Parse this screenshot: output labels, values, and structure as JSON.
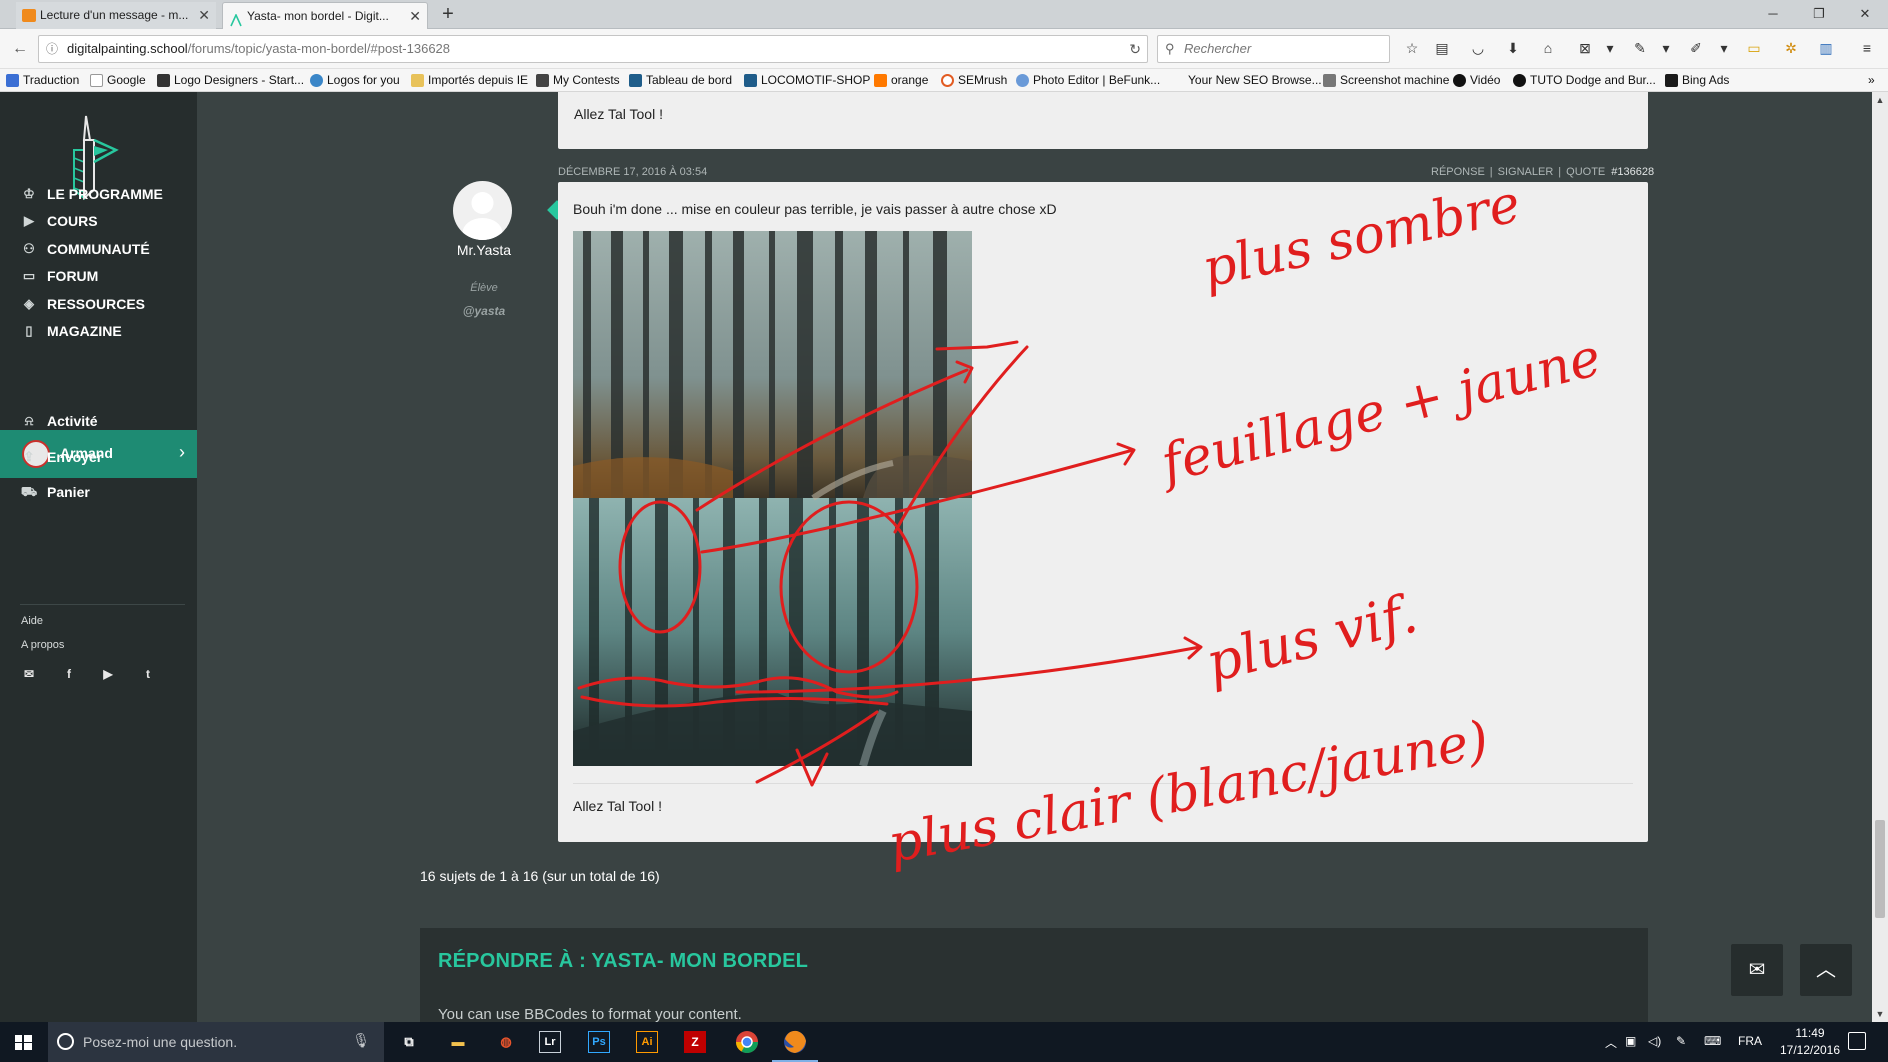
{
  "browser": {
    "tabs": [
      {
        "title": "Lecture d'un message - m..."
      },
      {
        "title": "Yasta- mon bordel - Digit..."
      }
    ],
    "new_tab_label": "+",
    "url_domain": "digitalpainting.school",
    "url_path": "/forums/topic/yasta-mon-bordel/#post-136628",
    "search_placeholder": "Rechercher",
    "bookmarks": [
      "Traduction",
      "Google",
      "Logo Designers - Start...",
      "Logos for you",
      "Importés depuis IE",
      "My Contests",
      "Tableau de bord",
      "LOCOMOTIF-SHOP",
      "orange",
      "SEMrush",
      "Photo Editor | BeFunk...",
      "Your New SEO Browse...",
      "Screenshot machine",
      "Vidéo",
      "TUTO Dodge and Bur...",
      "Bing Ads"
    ]
  },
  "sidebar": {
    "nav": [
      {
        "label": "LE PROGRAMME",
        "icon": "award-icon"
      },
      {
        "label": "COURS",
        "icon": "play-icon"
      },
      {
        "label": "COMMUNAUTÉ",
        "icon": "users-icon"
      },
      {
        "label": "FORUM",
        "icon": "chat-icon"
      },
      {
        "label": "RESSOURCES",
        "icon": "layers-icon"
      },
      {
        "label": "MAGAZINE",
        "icon": "book-icon"
      }
    ],
    "user": {
      "name": "Armand"
    },
    "subnav": [
      {
        "label": "Activité",
        "icon": "bell-icon"
      },
      {
        "label": "Envoyer",
        "icon": "upload-icon"
      },
      {
        "label": "Panier",
        "icon": "cart-icon"
      }
    ],
    "links": [
      "Aide",
      "A propos"
    ],
    "social": [
      "mail-icon",
      "facebook-icon",
      "youtube-icon",
      "twitter-icon"
    ]
  },
  "prev_post": {
    "text": "Allez Tal Tool !"
  },
  "post": {
    "date": "DÉCEMBRE 17, 2016 À 03:54",
    "actions": [
      "RÉPONSE",
      "SIGNALER",
      "QUOTE"
    ],
    "post_id": "#136628",
    "author": {
      "name": "Mr.Yasta",
      "role": "Élève",
      "handle": "@yasta"
    },
    "text": "Bouh i'm done ... mise en couleur pas terrible, je vais passer à autre chose xD",
    "footer": "Allez Tal Tool !",
    "annotations": [
      "plus sombre",
      "feuillage + jaune",
      "plus vif.",
      "plus clair (blanc/jaune)"
    ]
  },
  "topic_count": "16 sujets de 1 à 16 (sur un total de 16)",
  "reply": {
    "title": "RÉPONDRE À : YASTA- MON BORDEL",
    "hint": "You can use BBCodes to format your content."
  },
  "taskbar": {
    "search_placeholder": "Posez-moi une question.",
    "language": "FRA",
    "time": "11:49",
    "date": "17/12/2016"
  },
  "colors": {
    "accent": "#28c79e",
    "annotation": "#e01e1e",
    "sidebar": "#262d2d",
    "user_bar": "#1e8b73"
  }
}
